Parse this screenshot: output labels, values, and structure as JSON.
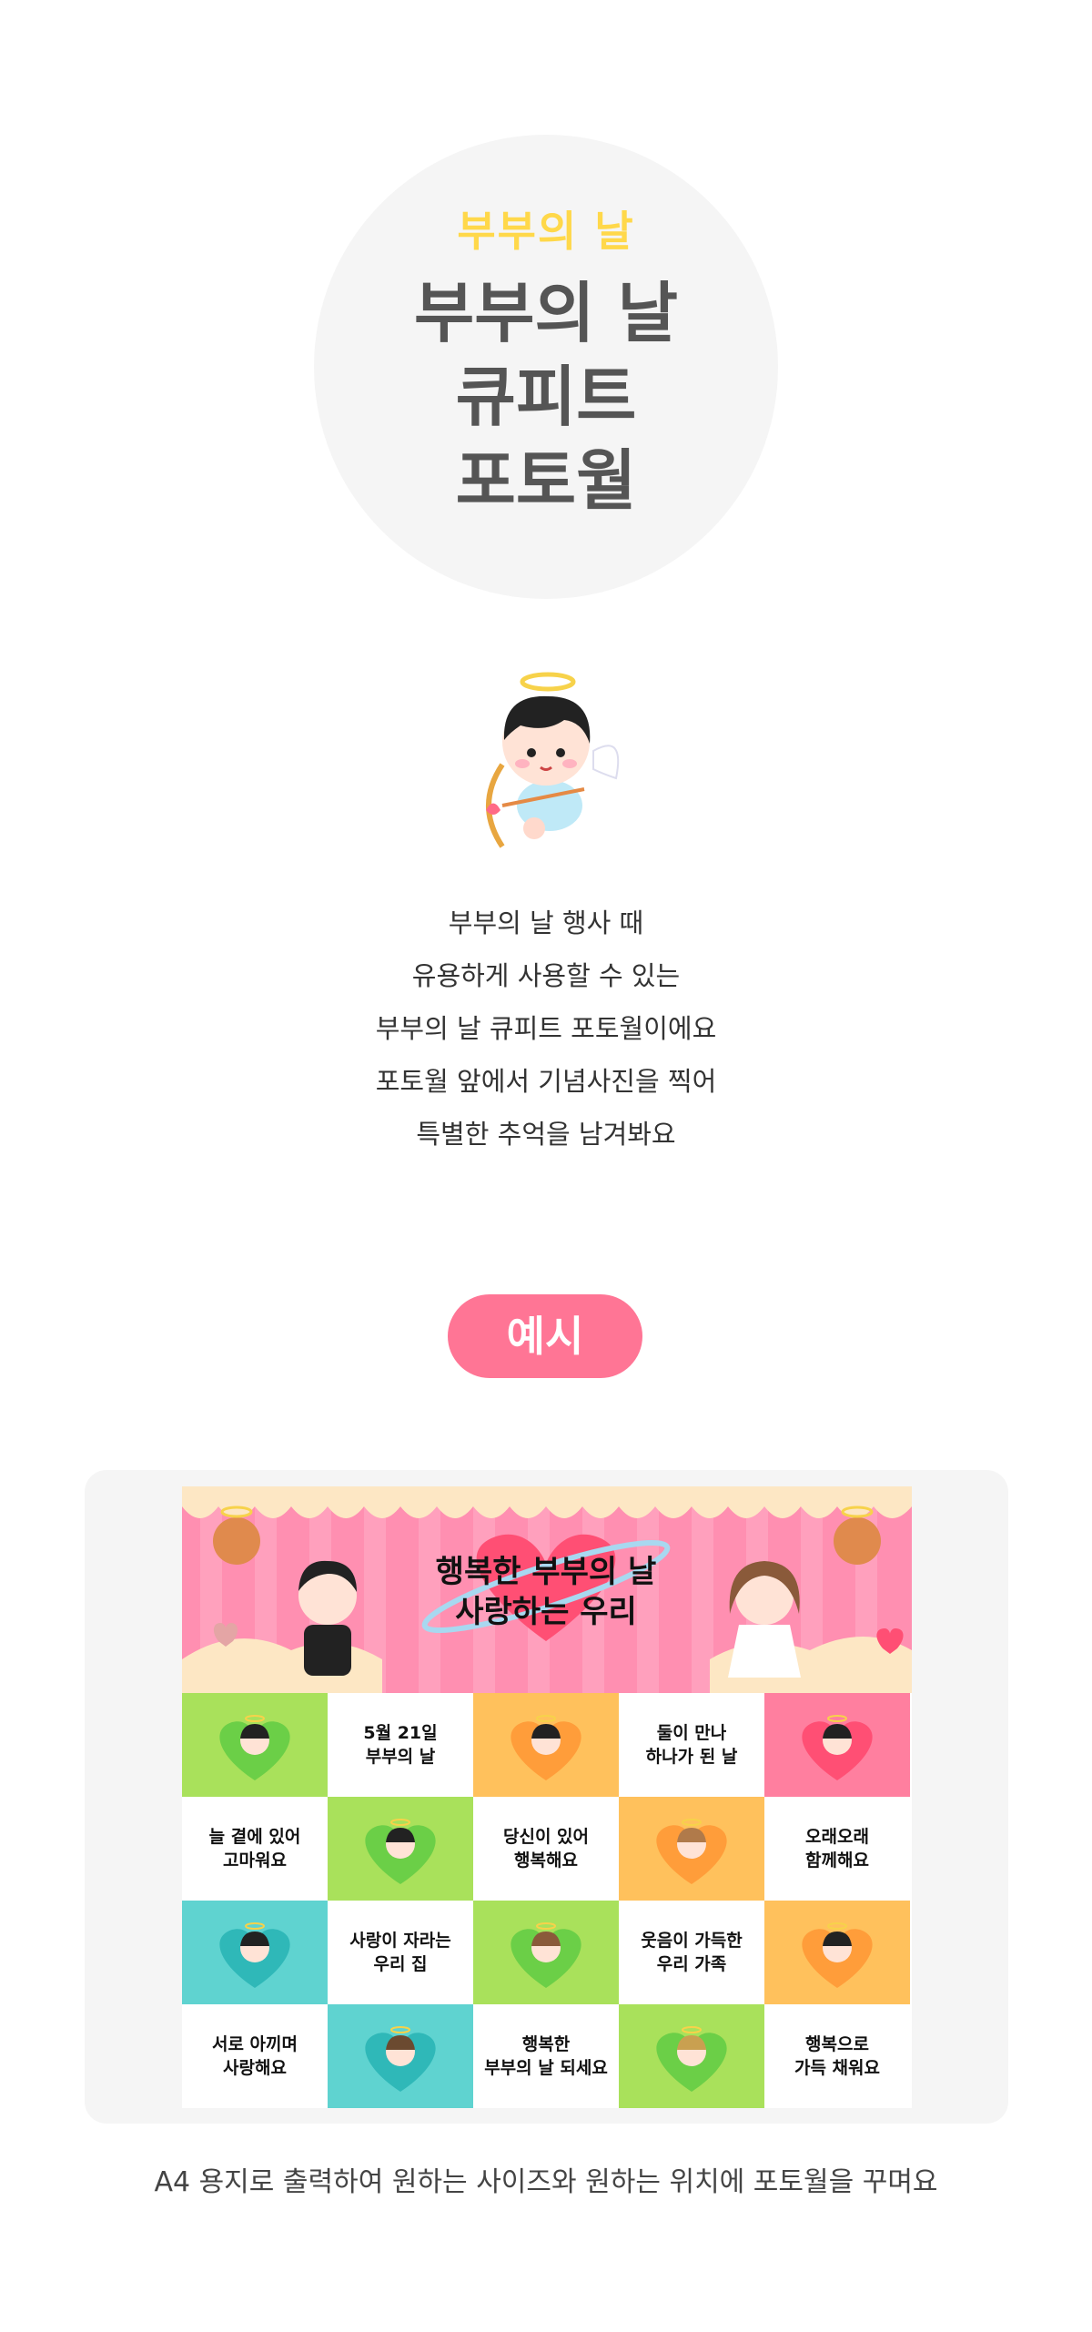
{
  "hero": {
    "subtitle": "부부의 날",
    "title_lines": [
      "부부의 날",
      "큐피트",
      "포토월"
    ]
  },
  "description": {
    "lines": [
      "부부의 날 행사 때",
      "유용하게 사용할 수 있는",
      "부부의 날 큐피트 포토월이에요",
      "포토월 앞에서 기념사진을 찍어",
      "특별한 추억을 남겨봐요"
    ]
  },
  "example_button": {
    "label": "예시"
  },
  "poster": {
    "title_lines": [
      "행복한 부부의 날",
      "사랑하는 우리"
    ],
    "messages": {
      "m1": [
        "5월 21일",
        "부부의 날"
      ],
      "m2": [
        "둘이 만나",
        "하나가 된 날"
      ],
      "m3": [
        "늘 곁에 있어",
        "고마워요"
      ],
      "m4": [
        "당신이 있어",
        "행복해요"
      ],
      "m5": [
        "오래오래",
        "함께해요"
      ],
      "m6": [
        "사랑이 자라는",
        "우리 집"
      ],
      "m7": [
        "웃음이 가득한",
        "우리 가족"
      ],
      "m8": [
        "서로 아끼며",
        "사랑해요"
      ],
      "m9": [
        "행복한",
        "부부의 날 되세요"
      ],
      "m10": [
        "행복으로",
        "가득 채워요"
      ]
    }
  },
  "footer": {
    "text": "A4 용지로 출력하여 원하는 사이즈와 원하는 위치에 포토월을 꾸며요"
  },
  "colors": {
    "accent_pink": "#ff7595",
    "title_yellow": "#ffd84a",
    "tile_green": "#a9e15b",
    "tile_orange": "#ffc15c",
    "tile_pink": "#ff7f9f",
    "tile_teal": "#5fd3d0"
  }
}
